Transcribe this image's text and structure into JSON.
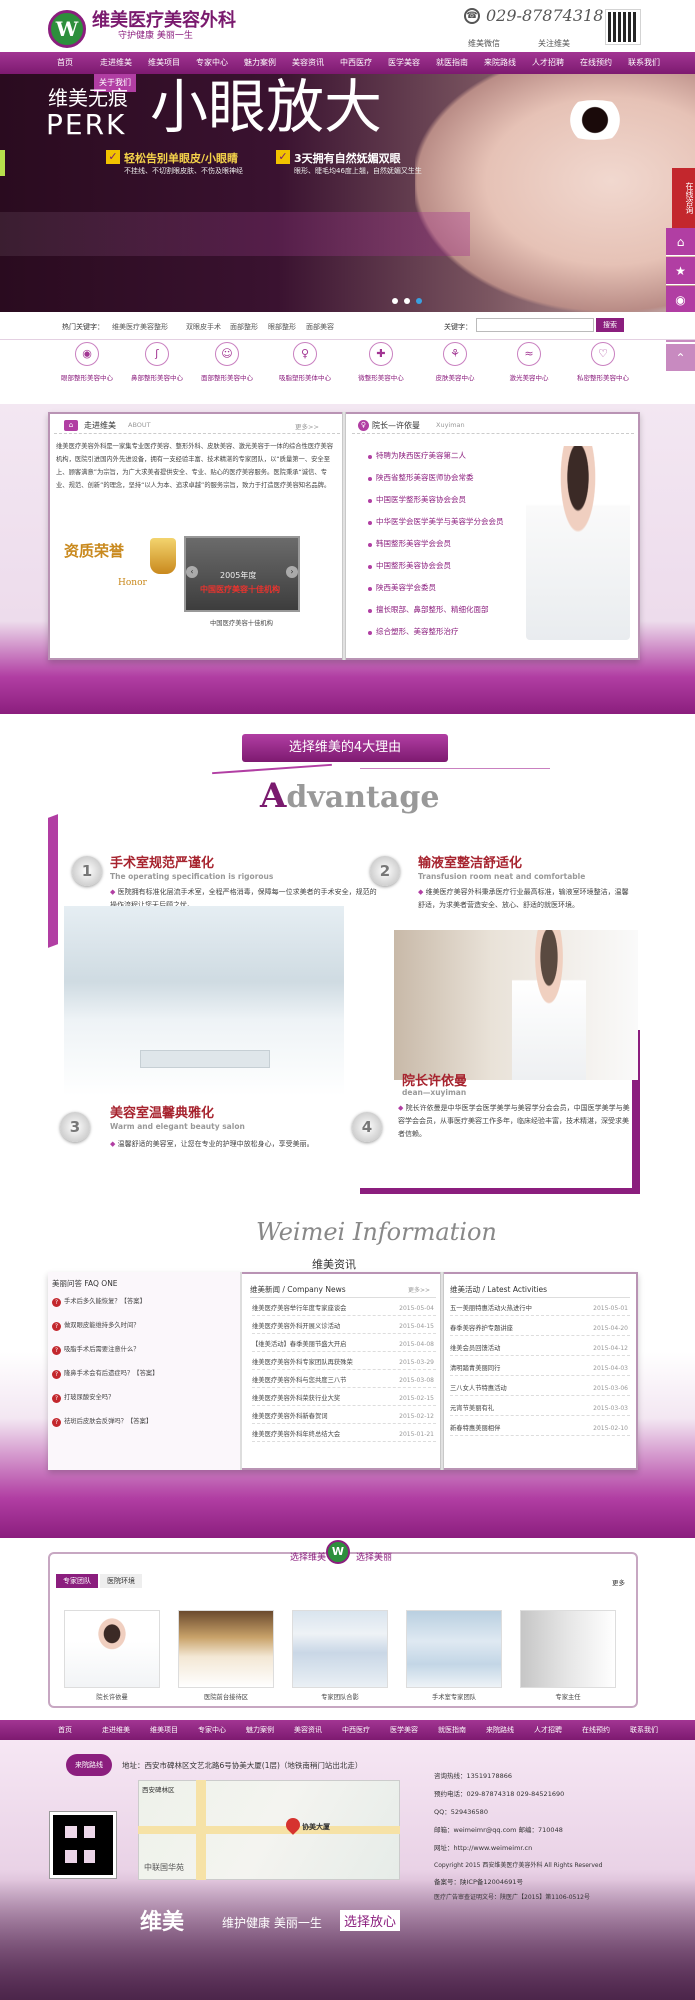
{
  "header": {
    "hospital_name": "维美医疗美容外科",
    "slogan": "守护健康 美丽一生",
    "phone": "029-87874318",
    "links": [
      "维美微信",
      "关注维美"
    ]
  },
  "nav": {
    "items": [
      "首页",
      "走进维美",
      "维美项目",
      "专家中心",
      "魅力案例",
      "美容资讯",
      "中西医疗",
      "医学美容",
      "就医指南",
      "来院路线",
      "人才招聘",
      "在线预约",
      "联系我们"
    ],
    "sub_item": "关于我们"
  },
  "banner": {
    "small_title": "维美无痕",
    "perk": "PERK",
    "big_title": "小眼放大",
    "point_1": "轻松告别单眼皮/小眼睛",
    "point_1_sub": "不挂线、不切割眼皮肤、不伤及眼神经",
    "point_2": "3天拥有自然妩媚双眼",
    "point_2_sub": "眼形、睫毛均46度上翘，自然妩媚又生生"
  },
  "float": {
    "consult": "在线咨询",
    "icons": [
      "home-icon",
      "star-icon",
      "eye-icon",
      "search-icon",
      "up-icon"
    ]
  },
  "search": {
    "hot_label": "热门关键字：",
    "hot_keywords": [
      "维美医疗美容整形",
      "双眼皮手术",
      "面部整形",
      "眼部整形",
      "面部美容"
    ],
    "label": "关键字：",
    "placeholder": "",
    "button": "搜索"
  },
  "categories": [
    {
      "icon": "eye-icon",
      "label": "眼部整形美容中心"
    },
    {
      "icon": "nose-icon",
      "label": "鼻部整形美容中心"
    },
    {
      "icon": "face-icon",
      "label": "面部整形美容中心"
    },
    {
      "icon": "body-icon",
      "label": "吸脂塑形美体中心"
    },
    {
      "icon": "shield-icon",
      "label": "微整形美容中心"
    },
    {
      "icon": "skin-icon",
      "label": "皮肤美容中心"
    },
    {
      "icon": "wave-icon",
      "label": "激光美容中心"
    },
    {
      "icon": "heart-icon",
      "label": "私密整形美容中心"
    }
  ],
  "about": {
    "title": "走进维美",
    "title_en": "ABOUT",
    "more": "更多>>",
    "text": "维美医疗美容外科是一家集专业医疗美容、整形外科、皮肤美容、激光美容于一体的综合性医疗美容机构，医院引进国内外先进设备，拥有一支经验丰富、技术精湛的专家团队，以“质量第一、安全至上、顾客满意”为宗旨，为广大求美者提供安全、专业、贴心的医疗美容服务。医院秉承“诚信、专业、规范、创新”的理念，坚持“以人为本、追求卓越”的服务宗旨，致力于打造医疗美容知名品牌。",
    "award_gold": "资质荣誉",
    "award_honor": "Honor",
    "plaque_year": "2005年度",
    "plaque_text": "中国医疗美容十佳机构",
    "plaque_caption": "中国医疗美容十佳机构"
  },
  "experts": {
    "title": "院长—许依曼",
    "title_en": "Xuyiman",
    "lines": [
      "特聘为陕西医疗美容第二人",
      "陕西省整形美容医师协会常委",
      "中国医学整形美容协会会员",
      "中华医学会医学美学与美容学分会会员",
      "韩国整形美容学会会员",
      "中国整形美容协会会员",
      "陕西美容学会委员",
      "擅长眼部、鼻部整形、精细化面部",
      "综合塑形、美容整形治疗"
    ]
  },
  "reasons": {
    "banner": "选择维美的4大理由",
    "advantage_first": "A",
    "advantage_rest": "dvantage",
    "items": [
      {
        "num": "1",
        "title": "手术室规范严谨化",
        "sub": "The operating specification is rigorous",
        "desc": "医院拥有标准化层流手术室，全程严格消毒，保障每一位求美者的手术安全，规范的操作流程让您无后顾之忧。"
      },
      {
        "num": "2",
        "title": "输液室整洁舒适化",
        "sub": "Transfusion room neat and comfortable",
        "desc": "维美医疗美容外科秉承医疗行业最高标准，输液室环境整洁，温馨舒适，为求美者营造安全、放心、舒适的就医环境。"
      },
      {
        "num": "3",
        "title": "美容室温馨典雅化",
        "sub": "Warm and elegant beauty salon",
        "desc": "温馨舒适的美容室，让您在专业的护理中放松身心，享受美丽。"
      },
      {
        "num": "4",
        "title": "院长许依曼",
        "sub": "dean—xuyiman",
        "desc": "院长许依曼是中华医学会医学美学与美容学分会会员，中国医学美学与美容学会会员，从事医疗美容工作多年，临床经验丰富，技术精湛，深受求美者信赖。"
      }
    ]
  },
  "info": {
    "script": "Weimei Information",
    "title": "维美资讯",
    "faq_head": "美丽问答 FAQ ONE",
    "faq": [
      "手术后多久能恢复？【答案】",
      "做双眼皮能维持多久时间？",
      "吸脂手术后需要注意什么？",
      "隆鼻手术会有后遗症吗？【答案】",
      "打玻尿酸安全吗？",
      "祛斑后皮肤会反弹吗？【答案】"
    ],
    "news_head": "维美新闻 / Company News",
    "news_more": "更多>>",
    "news": [
      {
        "title": "维美医疗美容举行年度专家座谈会",
        "date": "2015-05-04"
      },
      {
        "title": "维美医疗美容外科开展义诊活动",
        "date": "2015-04-15"
      },
      {
        "title": "【维美活动】春季美丽节盛大开启",
        "date": "2015-04-08"
      },
      {
        "title": "维美医疗美容外科专家团队再获殊荣",
        "date": "2015-03-29"
      },
      {
        "title": "维美医疗美容外科与您共度三八节",
        "date": "2015-03-08"
      },
      {
        "title": "维美医疗美容外科荣获行业大奖",
        "date": "2015-02-15"
      },
      {
        "title": "维美医疗美容外科新春贺词",
        "date": "2015-02-12"
      },
      {
        "title": "维美医疗美容外科年终总结大会",
        "date": "2015-01-21"
      }
    ],
    "events_head": "维美活动 / Latest Activities",
    "events": [
      {
        "title": "五一美丽特惠活动火热进行中",
        "date": "2015-05-01"
      },
      {
        "title": "春季美容养护专题讲座",
        "date": "2015-04-20"
      },
      {
        "title": "维美会员回馈活动",
        "date": "2015-04-12"
      },
      {
        "title": "清明踏青美丽同行",
        "date": "2015-04-03"
      },
      {
        "title": "三八女人节特惠活动",
        "date": "2015-03-06"
      },
      {
        "title": "元宵节美丽有礼",
        "date": "2015-03-03"
      },
      {
        "title": "新春特惠美丽相伴",
        "date": "2015-02-10"
      }
    ]
  },
  "environment": {
    "left": "选择维美",
    "right": "选择美丽",
    "emblem": "W",
    "tabs": [
      "专家团队",
      "医院环境"
    ],
    "more": "更多",
    "cards": [
      "院长许依曼",
      "医院前台接待区",
      "专家团队合影",
      "手术室专家团队",
      "专家主任"
    ]
  },
  "bottom_nav": [
    "首页",
    "走进维美",
    "维美项目",
    "专家中心",
    "魅力案例",
    "美容资讯",
    "中西医疗",
    "医学美容",
    "就医指南",
    "来院路线",
    "人才招聘",
    "在线预约",
    "联系我们"
  ],
  "footer": {
    "contact_badge": "来院路线",
    "address": "地址：西安市碑林区文艺北路6号协美大厦(1层)（地铁南稍门站出北走）",
    "map_labels": [
      "西安碑林区",
      "中联国华苑",
      "协美大厦"
    ],
    "lines": [
      "咨询热线：13519178866",
      "预约电话：029-87874318  029-84521690",
      "QQ：529436580",
      "邮箱：weimeimr@qq.com  邮编：710048",
      "网址：http://www.weimeimr.cn",
      "Copyright 2015 西安维美医疗美容外科 All Rights Reserved",
      "备案号：陕ICP备12004691号",
      "医疗广告审查证明文号：陕医广【2015】第1106-0512号"
    ],
    "brand": "维美",
    "slogan_1": "维护健康 美丽一生",
    "slogan_2": "选择放心"
  }
}
